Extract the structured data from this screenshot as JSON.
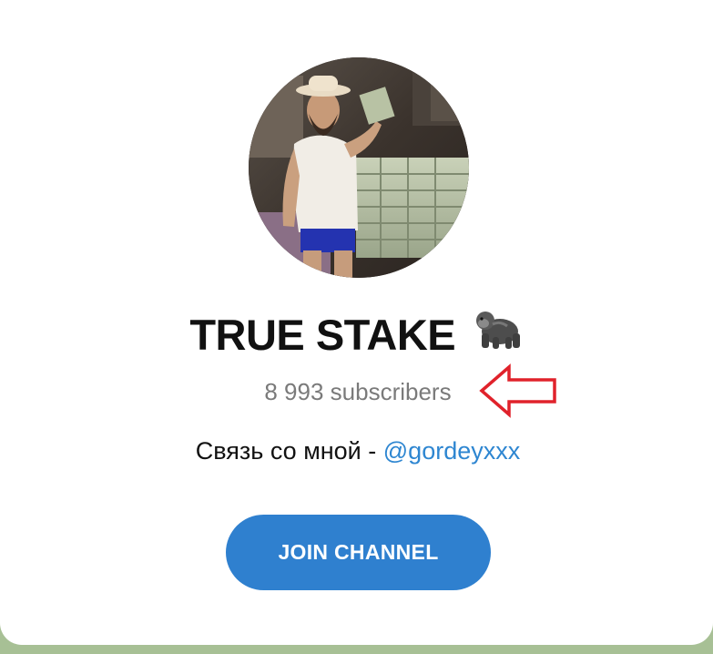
{
  "channel": {
    "name": "TRUE STAKE",
    "emoji": "🦍",
    "subscribers": "8 993 subscribers",
    "description_prefix": "Связь со мной - ",
    "description_mention": "@gordeyxxx",
    "avatar": "channel-avatar-photo"
  },
  "actions": {
    "join_label": "JOIN CHANNEL"
  },
  "annotation": {
    "icon": "arrow-left-outline-icon",
    "color": "#e0222b"
  },
  "colors": {
    "accent": "#2f80cf",
    "link": "#2e86d1",
    "muted_text": "#7a7a7a",
    "background": "#a9c39a"
  }
}
